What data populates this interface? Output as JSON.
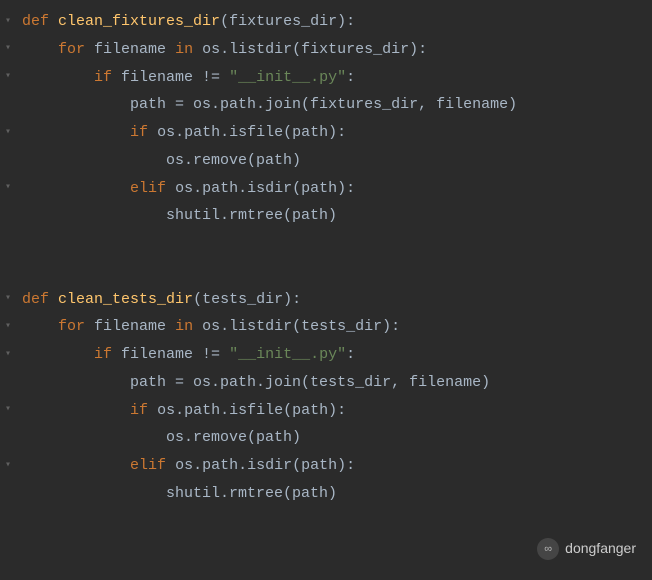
{
  "code": {
    "func1": {
      "def": "def",
      "name": "clean_fixtures_dir",
      "param": "fixtures_dir",
      "for": "for",
      "var": "filename",
      "in": "in",
      "listdir": "os.listdir(fixtures_dir):",
      "if1": "if",
      "cond1": "filename != ",
      "str1": "\"__init__.py\"",
      "colon1": ":",
      "assign": "path = os.path.join(fixtures_dir, filename)",
      "if2": "if",
      "isfile": "os.path.isfile(path):",
      "remove": "os.remove(path)",
      "elif": "elif",
      "isdir": "os.path.isdir(path):",
      "rmtree": "shutil.rmtree(path)"
    },
    "func2": {
      "def": "def",
      "name": "clean_tests_dir",
      "param": "tests_dir",
      "for": "for",
      "var": "filename",
      "in": "in",
      "listdir": "os.listdir(tests_dir):",
      "if1": "if",
      "cond1": "filename != ",
      "str1": "\"__init__.py\"",
      "colon1": ":",
      "assign": "path = os.path.join(tests_dir, filename)",
      "if2": "if",
      "isfile": "os.path.isfile(path):",
      "remove": "os.remove(path)",
      "elif": "elif",
      "isdir": "os.path.isdir(path):",
      "rmtree": "shutil.rmtree(path)"
    }
  },
  "watermark": {
    "text": "dongfanger",
    "icon": "∞"
  }
}
